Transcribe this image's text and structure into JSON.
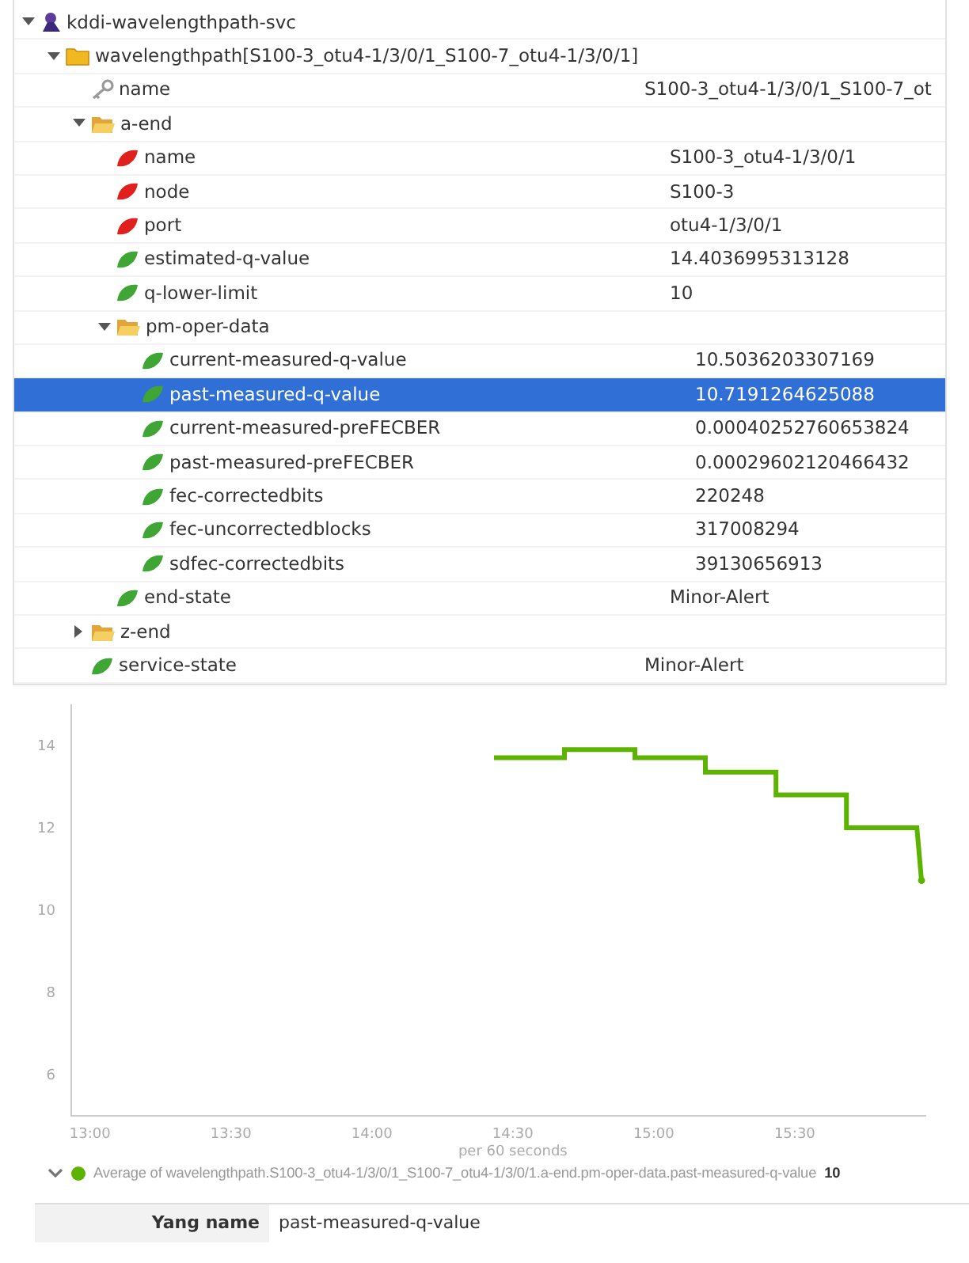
{
  "tree": [
    {
      "kind": "service",
      "label": "kddi-wavelengthpath-svc",
      "expanded": true,
      "selected": false,
      "children": [
        {
          "kind": "folder",
          "label": "wavelengthpath[S100-3_otu4-1/3/0/1_S100-7_otu4-1/3/0/1]",
          "expanded": true,
          "selected": false,
          "children": [
            {
              "kind": "key",
              "label": "name",
              "value": "S100-3_otu4-1/3/0/1_S100-7_ot",
              "selected": false
            },
            {
              "kind": "container",
              "label": "a-end",
              "expanded": true,
              "selected": false,
              "children": [
                {
                  "kind": "leaf",
                  "color": "#e0201c",
                  "label": "name",
                  "value": "S100-3_otu4-1/3/0/1",
                  "selected": false
                },
                {
                  "kind": "leaf",
                  "color": "#e0201c",
                  "label": "node",
                  "value": "S100-3",
                  "selected": false
                },
                {
                  "kind": "leaf",
                  "color": "#e0201c",
                  "label": "port",
                  "value": "otu4-1/3/0/1",
                  "selected": false
                },
                {
                  "kind": "leaf",
                  "color": "#3fa535",
                  "label": "estimated-q-value",
                  "value": "14.4036995313128",
                  "selected": false
                },
                {
                  "kind": "leaf",
                  "color": "#3fa535",
                  "label": "q-lower-limit",
                  "value": "10",
                  "selected": false
                },
                {
                  "kind": "container",
                  "label": "pm-oper-data",
                  "expanded": true,
                  "selected": false,
                  "children": [
                    {
                      "kind": "leaf",
                      "color": "#3fa535",
                      "label": "current-measured-q-value",
                      "value": "10.5036203307169",
                      "selected": false
                    },
                    {
                      "kind": "leaf",
                      "color": "#3fa535",
                      "label": "past-measured-q-value",
                      "value": "10.7191264625088",
                      "selected": true
                    },
                    {
                      "kind": "leaf",
                      "color": "#3fa535",
                      "label": "current-measured-preFECBER",
                      "value": "0.00040252760653824",
                      "selected": false
                    },
                    {
                      "kind": "leaf",
                      "color": "#3fa535",
                      "label": "past-measured-preFECBER",
                      "value": "0.00029602120466432",
                      "selected": false
                    },
                    {
                      "kind": "leaf",
                      "color": "#3fa535",
                      "label": "fec-correctedbits",
                      "value": "220248",
                      "selected": false
                    },
                    {
                      "kind": "leaf",
                      "color": "#3fa535",
                      "label": "fec-uncorrectedblocks",
                      "value": "317008294",
                      "selected": false
                    },
                    {
                      "kind": "leaf",
                      "color": "#3fa535",
                      "label": "sdfec-correctedbits",
                      "value": "39130656913",
                      "selected": false
                    }
                  ]
                },
                {
                  "kind": "leaf",
                  "color": "#3fa535",
                  "label": "end-state",
                  "value": "Minor-Alert",
                  "selected": false
                }
              ]
            },
            {
              "kind": "container",
              "label": "z-end",
              "expanded": false,
              "selected": false
            },
            {
              "kind": "leaf",
              "color": "#3fa535",
              "label": "service-state",
              "value": "Minor-Alert",
              "selected": false
            }
          ]
        }
      ]
    }
  ],
  "chart": {
    "chart_data": {
      "type": "line",
      "xlabel": "per 60 seconds",
      "x": [
        866,
        881,
        881,
        896,
        896,
        911,
        911,
        926,
        926,
        941,
        941,
        956,
        957
      ],
      "series": [
        {
          "name": "Average of wavelengthpath.S100-3_otu4-1/3/0/1_S100-7_otu4-1/3/0/1.a-end.pm-oper-data.past-measured-q-value",
          "color": "#5cb300",
          "values": [
            13.7,
            13.7,
            13.9,
            13.9,
            13.7,
            13.7,
            13.35,
            13.35,
            12.8,
            12.8,
            12.0,
            12.0,
            10.72
          ]
        }
      ],
      "xlim": [
        776,
        958
      ],
      "ylim": [
        5,
        15
      ],
      "xticks": [
        {
          "value": 780,
          "label": "13:00"
        },
        {
          "value": 810,
          "label": "13:30"
        },
        {
          "value": 840,
          "label": "14:00"
        },
        {
          "value": 870,
          "label": "14:30"
        },
        {
          "value": 900,
          "label": "15:00"
        },
        {
          "value": 930,
          "label": "15:30"
        }
      ],
      "yticks": [
        6,
        8,
        10,
        12,
        14
      ]
    },
    "legend": {
      "expanded": true,
      "value": "10"
    }
  },
  "details": [
    {
      "label": "Yang name",
      "value": "past-measured-q-value"
    }
  ]
}
